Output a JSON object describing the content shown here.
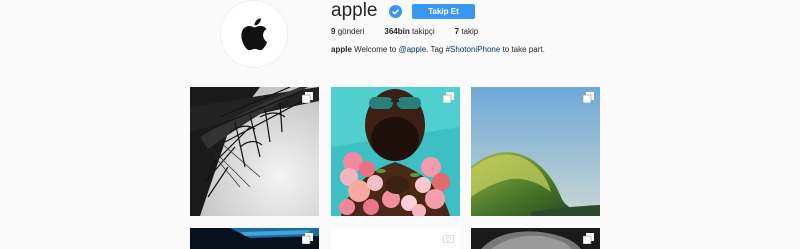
{
  "profile": {
    "username": "apple",
    "follow_label": "Takip Et",
    "stats": [
      {
        "value": "9",
        "label": "gönderi"
      },
      {
        "value": "364bin",
        "label": "takipçi"
      },
      {
        "value": "7",
        "label": "takip"
      }
    ],
    "bio": {
      "name": "apple",
      "text_before": "Welcome to",
      "mention": "@apple",
      "text_middle": ". Tag",
      "hashtag": "#ShotoniPhone",
      "text_after": "to take part."
    }
  },
  "grid": {
    "posts": [
      {
        "subject": "Eiffel Tower ironwork, black and white",
        "multi": true
      },
      {
        "subject": "Man with sunglasses and flower garland",
        "multi": true
      },
      {
        "subject": "Wave curling against blue sky",
        "multi": true
      },
      {
        "subject": "Dark blue abstract",
        "multi": true
      },
      {
        "subject": "White image",
        "multi": false,
        "video": true
      },
      {
        "subject": "Black and white portrait",
        "multi": true
      }
    ]
  },
  "colors": {
    "accent": "#3897f0",
    "link": "#003569",
    "background": "#fafafa"
  }
}
